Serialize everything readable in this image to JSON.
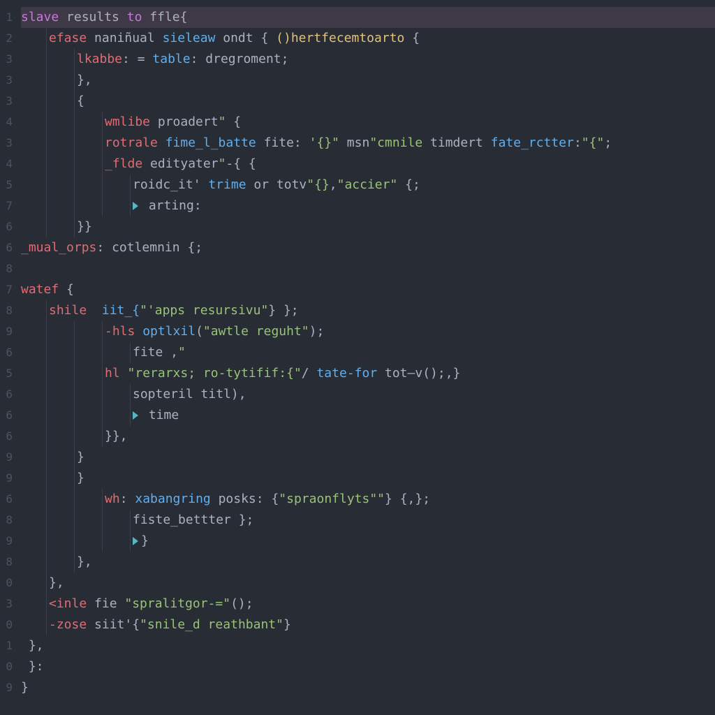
{
  "editor": {
    "gutter_numbers": [
      "1",
      "2",
      "3",
      "3",
      "3",
      "4",
      "3",
      "4",
      "5",
      "7",
      "6",
      "6",
      "8",
      "7",
      "8",
      "9",
      "6",
      "5",
      "6",
      "6",
      "6",
      "9",
      "9",
      "6",
      "8",
      "9",
      "8",
      "0",
      "3",
      "0",
      "1",
      "0",
      "9"
    ],
    "highlighted_line_index": 0,
    "lines": [
      {
        "indent": 0,
        "tokens": [
          {
            "cls": "tk-keyword",
            "text": "slave"
          },
          {
            "cls": "tk-ident",
            "text": " results "
          },
          {
            "cls": "tk-keyword",
            "text": "to"
          },
          {
            "cls": "tk-ident",
            "text": " ffle"
          },
          {
            "cls": "tk-punct",
            "text": "{"
          }
        ]
      },
      {
        "indent": 1,
        "tokens": [
          {
            "cls": "tk-keyword2",
            "text": "efase"
          },
          {
            "cls": "tk-ident",
            "text": " naniñual "
          },
          {
            "cls": "tk-func",
            "text": "sieleaw"
          },
          {
            "cls": "tk-ident",
            "text": " ondt "
          },
          {
            "cls": "tk-punct",
            "text": "{ "
          },
          {
            "cls": "tk-yellow",
            "text": "()hertfecemtoarto"
          },
          {
            "cls": "tk-punct",
            "text": " {"
          }
        ]
      },
      {
        "indent": 2,
        "tokens": [
          {
            "cls": "tk-keyword2",
            "text": "lkabbe"
          },
          {
            "cls": "tk-punct",
            "text": ": = "
          },
          {
            "cls": "tk-func",
            "text": "table"
          },
          {
            "cls": "tk-punct",
            "text": ": "
          },
          {
            "cls": "tk-ident",
            "text": "dregroment"
          },
          {
            "cls": "tk-punct",
            "text": ";"
          }
        ]
      },
      {
        "indent": 2,
        "tokens": [
          {
            "cls": "tk-punct",
            "text": "},"
          }
        ]
      },
      {
        "indent": 2,
        "tokens": [
          {
            "cls": "tk-punct",
            "text": "{"
          }
        ]
      },
      {
        "indent": 3,
        "tokens": [
          {
            "cls": "tk-keyword2",
            "text": "wmlibe"
          },
          {
            "cls": "tk-ident",
            "text": " proadert"
          },
          {
            "cls": "tk-string",
            "text": "\""
          },
          {
            "cls": "tk-punct",
            "text": " {"
          }
        ]
      },
      {
        "indent": 3,
        "tokens": [
          {
            "cls": "tk-keyword2",
            "text": "rotrale"
          },
          {
            "cls": "tk-ident",
            "text": " "
          },
          {
            "cls": "tk-func",
            "text": "fime_l_batte"
          },
          {
            "cls": "tk-ident",
            "text": " fite: "
          },
          {
            "cls": "tk-string",
            "text": "'{}\""
          },
          {
            "cls": "tk-ident",
            "text": " msn"
          },
          {
            "cls": "tk-string",
            "text": "\"cmnile"
          },
          {
            "cls": "tk-ident",
            "text": " timdert "
          },
          {
            "cls": "tk-func",
            "text": "fate_rctter"
          },
          {
            "cls": "tk-punct",
            "text": ":"
          },
          {
            "cls": "tk-string",
            "text": "\"{\""
          },
          {
            "cls": "tk-punct",
            "text": ";"
          }
        ]
      },
      {
        "indent": 3,
        "tokens": [
          {
            "cls": "tk-keyword2",
            "text": "_flde"
          },
          {
            "cls": "tk-ident",
            "text": " edityater"
          },
          {
            "cls": "tk-string",
            "text": "\""
          },
          {
            "cls": "tk-punct",
            "text": "-{ {"
          }
        ]
      },
      {
        "indent": 4,
        "tokens": [
          {
            "cls": "tk-ident",
            "text": "roidc_it' "
          },
          {
            "cls": "tk-func",
            "text": "trime"
          },
          {
            "cls": "tk-ident",
            "text": " or totv"
          },
          {
            "cls": "tk-string",
            "text": "\"{}"
          },
          {
            "cls": "tk-punct",
            "text": ","
          },
          {
            "cls": "tk-string",
            "text": "\"accier\""
          },
          {
            "cls": "tk-punct",
            "text": " {;"
          }
        ]
      },
      {
        "indent": 4,
        "tokens": [
          {
            "cls": "tk-accent",
            "text": "▶"
          },
          {
            "cls": "tk-ident",
            "text": " arting"
          },
          {
            "cls": "tk-punct",
            "text": ":"
          }
        ]
      },
      {
        "indent": 2,
        "tokens": [
          {
            "cls": "tk-punct",
            "text": "}}"
          }
        ]
      },
      {
        "indent": 0,
        "tokens": [
          {
            "cls": "tk-keyword2",
            "text": "_mual_orps"
          },
          {
            "cls": "tk-punct",
            "text": ": "
          },
          {
            "cls": "tk-ident",
            "text": "cotlemnin "
          },
          {
            "cls": "tk-punct",
            "text": "{;"
          }
        ]
      },
      {
        "indent": 0,
        "tokens": []
      },
      {
        "indent": 0,
        "tokens": [
          {
            "cls": "tk-keyword2",
            "text": "watef"
          },
          {
            "cls": "tk-punct",
            "text": " {"
          }
        ]
      },
      {
        "indent": 1,
        "tokens": [
          {
            "cls": "tk-keyword2",
            "text": "shile"
          },
          {
            "cls": "tk-ident",
            "text": "  "
          },
          {
            "cls": "tk-func",
            "text": "iit_{"
          },
          {
            "cls": "tk-string",
            "text": "\"'apps resursivu\""
          },
          {
            "cls": "tk-punct",
            "text": "} };"
          }
        ]
      },
      {
        "indent": 3,
        "tokens": [
          {
            "cls": "tk-keyword2",
            "text": "-hls"
          },
          {
            "cls": "tk-ident",
            "text": " "
          },
          {
            "cls": "tk-func",
            "text": "optlxil"
          },
          {
            "cls": "tk-punct",
            "text": "("
          },
          {
            "cls": "tk-string",
            "text": "\"awtle reguht\""
          },
          {
            "cls": "tk-punct",
            "text": ");"
          }
        ]
      },
      {
        "indent": 4,
        "tokens": [
          {
            "cls": "tk-ident",
            "text": "fite ,"
          },
          {
            "cls": "tk-string",
            "text": "\""
          }
        ]
      },
      {
        "indent": 3,
        "tokens": [
          {
            "cls": "tk-keyword2",
            "text": "hl"
          },
          {
            "cls": "tk-ident",
            "text": " "
          },
          {
            "cls": "tk-string",
            "text": "\"rerarxs; ro-tytifif:{\""
          },
          {
            "cls": "tk-punct",
            "text": "/ "
          },
          {
            "cls": "tk-func",
            "text": "tate-for"
          },
          {
            "cls": "tk-ident",
            "text": " tot–v"
          },
          {
            "cls": "tk-punct",
            "text": "();,}"
          }
        ]
      },
      {
        "indent": 4,
        "tokens": [
          {
            "cls": "tk-ident",
            "text": "sopteril titl"
          },
          {
            "cls": "tk-punct",
            "text": "),"
          }
        ]
      },
      {
        "indent": 4,
        "tokens": [
          {
            "cls": "tk-accent",
            "text": "▶"
          },
          {
            "cls": "tk-ident",
            "text": " time"
          }
        ]
      },
      {
        "indent": 3,
        "tokens": [
          {
            "cls": "tk-punct",
            "text": "}},"
          }
        ]
      },
      {
        "indent": 2,
        "tokens": [
          {
            "cls": "tk-punct",
            "text": "}"
          }
        ]
      },
      {
        "indent": 2,
        "tokens": [
          {
            "cls": "tk-punct",
            "text": "}"
          }
        ]
      },
      {
        "indent": 3,
        "tokens": [
          {
            "cls": "tk-keyword2",
            "text": "wh"
          },
          {
            "cls": "tk-punct",
            "text": ": "
          },
          {
            "cls": "tk-func",
            "text": "xabangring"
          },
          {
            "cls": "tk-ident",
            "text": " posks"
          },
          {
            "cls": "tk-punct",
            "text": ": {"
          },
          {
            "cls": "tk-string",
            "text": "\"spraonflyts\"\""
          },
          {
            "cls": "tk-punct",
            "text": "} {,};"
          }
        ]
      },
      {
        "indent": 4,
        "tokens": [
          {
            "cls": "tk-ident",
            "text": "fiste_bettter "
          },
          {
            "cls": "tk-punct",
            "text": "};"
          }
        ]
      },
      {
        "indent": 4,
        "tokens": [
          {
            "cls": "tk-accent",
            "text": "▶"
          },
          {
            "cls": "tk-punct",
            "text": "}"
          }
        ]
      },
      {
        "indent": 2,
        "tokens": [
          {
            "cls": "tk-punct",
            "text": "},"
          }
        ]
      },
      {
        "indent": 1,
        "tokens": [
          {
            "cls": "tk-punct",
            "text": "},"
          }
        ]
      },
      {
        "indent": 1,
        "tokens": [
          {
            "cls": "tk-keyword2",
            "text": "<inle"
          },
          {
            "cls": "tk-ident",
            "text": " fie "
          },
          {
            "cls": "tk-string",
            "text": "\"spralitgor-=\""
          },
          {
            "cls": "tk-punct",
            "text": "();"
          }
        ]
      },
      {
        "indent": 1,
        "tokens": [
          {
            "cls": "tk-keyword2",
            "text": "-zose"
          },
          {
            "cls": "tk-ident",
            "text": " siit'"
          },
          {
            "cls": "tk-punct",
            "text": "{"
          },
          {
            "cls": "tk-string",
            "text": "\"snile_d reathbant\""
          },
          {
            "cls": "tk-punct",
            "text": "}"
          }
        ]
      },
      {
        "indent": 0,
        "tokens": [
          {
            "cls": "tk-punct",
            "text": " },"
          }
        ]
      },
      {
        "indent": 0,
        "tokens": [
          {
            "cls": "tk-punct",
            "text": " }:"
          }
        ]
      },
      {
        "indent": 0,
        "tokens": [
          {
            "cls": "tk-punct",
            "text": "}"
          }
        ]
      }
    ]
  }
}
